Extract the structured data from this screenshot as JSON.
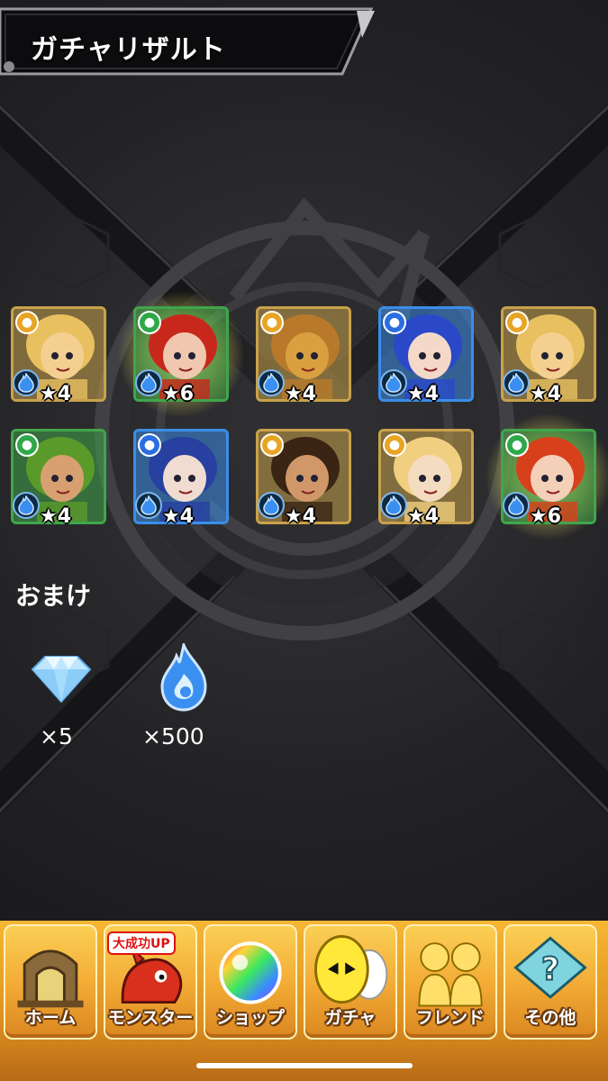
{
  "screen": {
    "title": "ガチャリザルト"
  },
  "results": [
    {
      "rarity": "★4",
      "attr_color": "#e8a524",
      "frame": "#c9a24a",
      "glow": false,
      "skin": "#f4d090",
      "hair": "#e8c060"
    },
    {
      "rarity": "★6",
      "attr_color": "#2fa84a",
      "frame": "#3fa64b",
      "glow": true,
      "skin": "#f0c8b0",
      "hair": "#c8281c"
    },
    {
      "rarity": "★4",
      "attr_color": "#e8a524",
      "frame": "#c9a24a",
      "glow": false,
      "skin": "#d8a040",
      "hair": "#b8792a"
    },
    {
      "rarity": "★4",
      "attr_color": "#2a6ee0",
      "frame": "#3a8ee8",
      "glow": false,
      "skin": "#f4d8c8",
      "hair": "#2a48c8"
    },
    {
      "rarity": "★4",
      "attr_color": "#e8a524",
      "frame": "#c9a24a",
      "glow": false,
      "skin": "#f4d090",
      "hair": "#e8c060"
    },
    {
      "rarity": "★4",
      "attr_color": "#2fa84a",
      "frame": "#3fa64b",
      "glow": false,
      "skin": "#d8a070",
      "hair": "#5a9a2a"
    },
    {
      "rarity": "★4",
      "attr_color": "#2a6ee0",
      "frame": "#3a8ee8",
      "glow": false,
      "skin": "#f0dcd0",
      "hair": "#2840a0"
    },
    {
      "rarity": "★4",
      "attr_color": "#e8a524",
      "frame": "#c9a24a",
      "glow": false,
      "skin": "#d09868",
      "hair": "#3a2414"
    },
    {
      "rarity": "★4",
      "attr_color": "#e8a524",
      "frame": "#c9a24a",
      "glow": false,
      "skin": "#f4dcc0",
      "hair": "#f0d080"
    },
    {
      "rarity": "★6",
      "attr_color": "#2fa84a",
      "frame": "#3fa64b",
      "glow": true,
      "skin": "#f4d0b8",
      "hair": "#d8401c"
    }
  ],
  "bonus": {
    "label": "おまけ",
    "items": [
      {
        "icon": "diamond-icon",
        "count": "×5"
      },
      {
        "icon": "blue-flame-icon",
        "count": "×500"
      }
    ]
  },
  "nav": {
    "items": [
      {
        "label": "ホーム",
        "icon": "home-gate-icon"
      },
      {
        "label": "モンスター",
        "icon": "monster-dragon-icon",
        "badge": "大成功UP"
      },
      {
        "label": "ショップ",
        "icon": "rainbow-orb-icon"
      },
      {
        "label": "ガチャ",
        "icon": "gacha-egg-icon"
      },
      {
        "label": "フレンド",
        "icon": "friends-icon"
      },
      {
        "label": "その他",
        "icon": "other-menu-icon"
      }
    ]
  }
}
